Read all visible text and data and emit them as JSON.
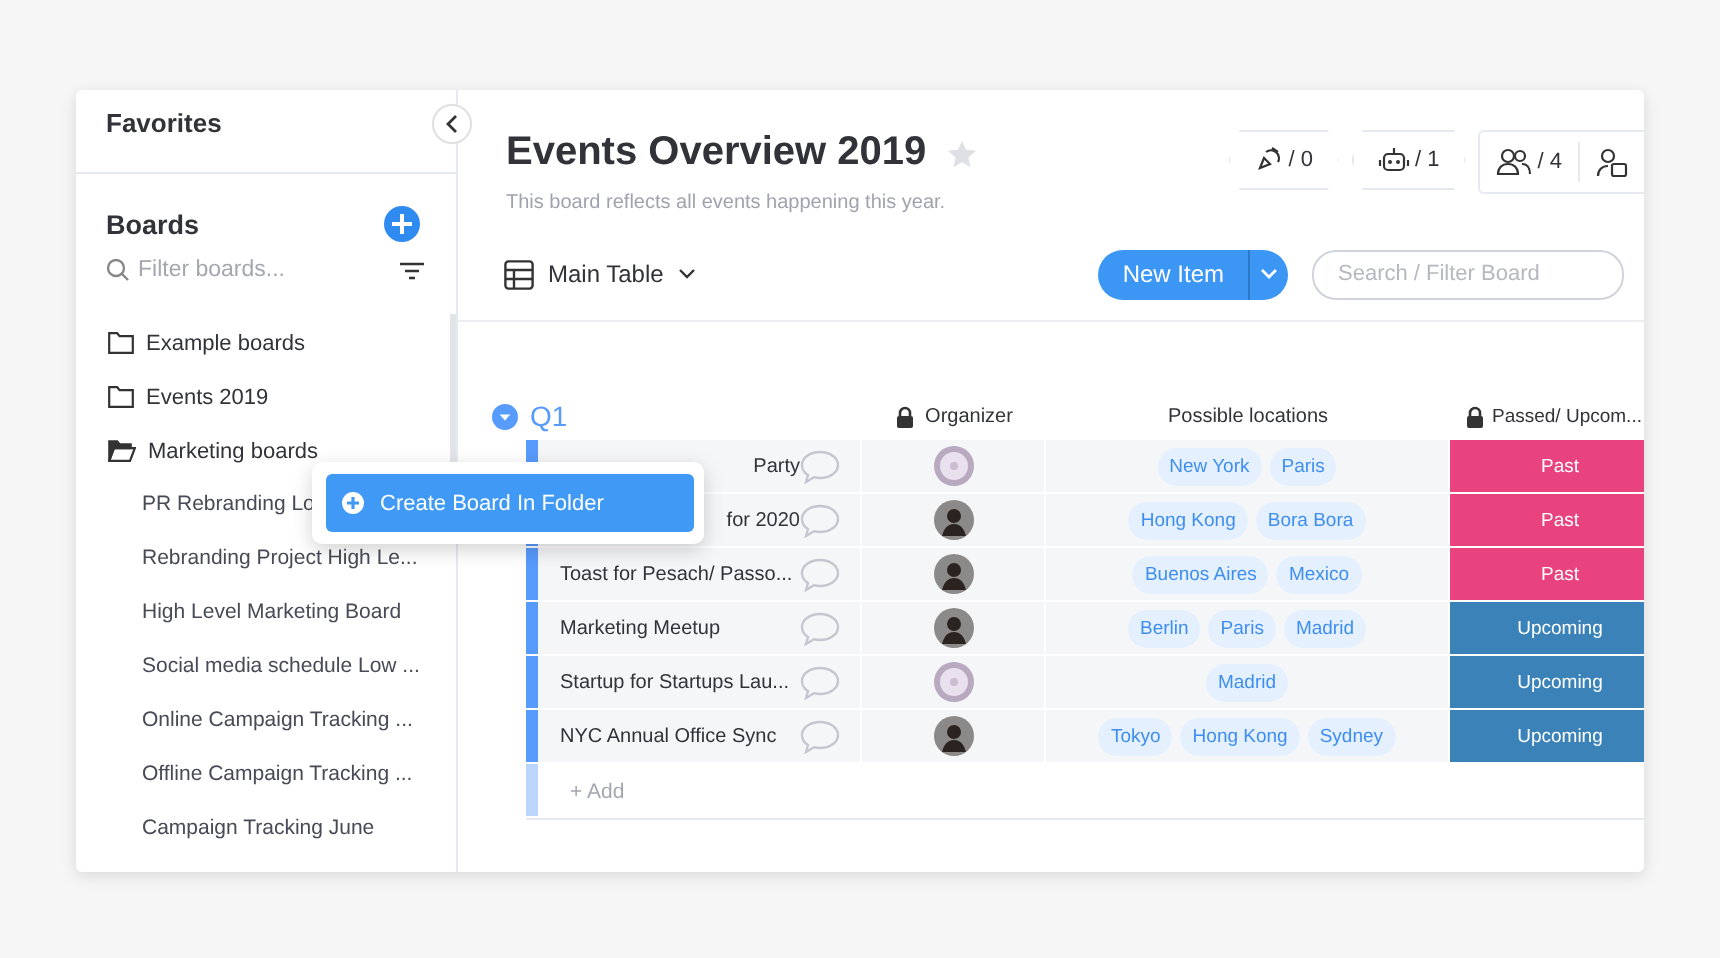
{
  "sidebar": {
    "favorites_title": "Favorites",
    "boards_title": "Boards",
    "filter": {
      "placeholder": "Filter boards..."
    },
    "folders": [
      {
        "label": "Example boards",
        "expanded": false
      },
      {
        "label": "Events 2019",
        "expanded": false
      },
      {
        "label": "Marketing boards",
        "expanded": true,
        "children": [
          {
            "label": "PR Rebranding Lo"
          },
          {
            "label": "Rebranding Project High Le..."
          },
          {
            "label": "High Level Marketing Board"
          },
          {
            "label": "Social media schedule Low ..."
          },
          {
            "label": "Online Campaign Tracking ..."
          },
          {
            "label": "Offline Campaign Tracking ..."
          },
          {
            "label": "Campaign Tracking June"
          }
        ]
      }
    ]
  },
  "context_menu": {
    "items": [
      {
        "label": "Create Board In Folder"
      }
    ]
  },
  "board": {
    "title": "Events Overview 2019",
    "starred": false,
    "description": "This board reflects all events happening this year.",
    "counters": [
      {
        "kind": "activity",
        "value": "/ 0"
      },
      {
        "kind": "automation",
        "value": "/ 1"
      },
      {
        "kind": "members",
        "value": "/ 4"
      }
    ],
    "view": "Main Table",
    "new_item": "New Item",
    "search": {
      "placeholder": "Search / Filter Board"
    }
  },
  "table": {
    "group": "Q1",
    "columns": [
      {
        "label": "Organizer",
        "locked": true
      },
      {
        "label": "Possible locations",
        "locked": false
      },
      {
        "label": "Passed/ Upcom...",
        "locked": true
      }
    ],
    "rows": [
      {
        "name": "Party",
        "partial": true,
        "organizer": {
          "kind": "flower"
        },
        "locations": [
          "New York",
          "Paris"
        ],
        "status": {
          "label": "Past",
          "color": "#e8437f"
        }
      },
      {
        "name": "for 2020",
        "partial": true,
        "organizer": {
          "kind": "person"
        },
        "locations": [
          "Hong Kong",
          "Bora Bora"
        ],
        "status": {
          "label": "Past",
          "color": "#e8437f"
        }
      },
      {
        "name": "Toast for Pesach/ Passo...",
        "partial": false,
        "organizer": {
          "kind": "person"
        },
        "locations": [
          "Buenos Aires",
          "Mexico"
        ],
        "status": {
          "label": "Past",
          "color": "#e8437f"
        }
      },
      {
        "name": "Marketing Meetup",
        "partial": false,
        "organizer": {
          "kind": "person"
        },
        "locations": [
          "Berlin",
          "Paris",
          "Madrid"
        ],
        "status": {
          "label": "Upcoming",
          "color": "#3a82b8"
        }
      },
      {
        "name": "Startup for Startups Lau...",
        "partial": false,
        "organizer": {
          "kind": "flower"
        },
        "locations": [
          "Madrid"
        ],
        "status": {
          "label": "Upcoming",
          "color": "#3a82b8"
        }
      },
      {
        "name": "NYC Annual Office Sync",
        "partial": false,
        "organizer": {
          "kind": "person"
        },
        "locations": [
          "Tokyo",
          "Hong Kong",
          "Sydney"
        ],
        "status": {
          "label": "Upcoming",
          "color": "#3a82b8"
        }
      }
    ],
    "add_label": "+ Add"
  }
}
